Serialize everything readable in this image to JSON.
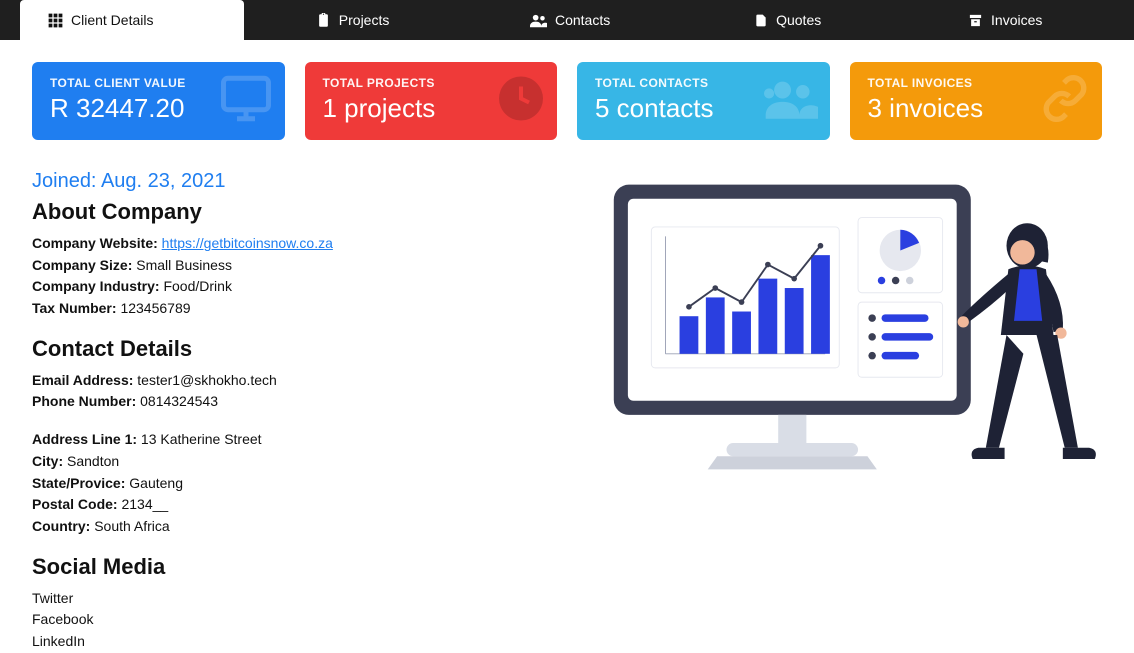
{
  "tabs": [
    {
      "label": "Client Details"
    },
    {
      "label": "Projects"
    },
    {
      "label": "Contacts"
    },
    {
      "label": "Quotes"
    },
    {
      "label": "Invoices"
    }
  ],
  "stats": {
    "client_value": {
      "label": "TOTAL CLIENT VALUE",
      "value": "R 32447.20"
    },
    "projects": {
      "label": "TOTAL PROJECTS",
      "value": "1 projects"
    },
    "contacts": {
      "label": "TOTAL CONTACTS",
      "value": "5 contacts"
    },
    "invoices": {
      "label": "TOTAL INVOICES",
      "value": "3 invoices"
    }
  },
  "joined_label": "Joined: Aug. 23, 2021",
  "about": {
    "heading": "About Company",
    "website_label": "Company Website:",
    "website_value": "https://getbitcoinsnow.co.za",
    "size_label": "Company Size:",
    "size_value": "Small Business",
    "industry_label": "Company Industry:",
    "industry_value": "Food/Drink",
    "tax_label": "Tax Number:",
    "tax_value": "123456789"
  },
  "contact": {
    "heading": "Contact Details",
    "email_label": "Email Address:",
    "email_value": "tester1@skhokho.tech",
    "phone_label": "Phone Number:",
    "phone_value": "0814324543",
    "addr1_label": "Address Line 1:",
    "addr1_value": "13 Katherine Street",
    "city_label": "City:",
    "city_value": "Sandton",
    "state_label": "State/Provice:",
    "state_value": "Gauteng",
    "postal_label": "Postal Code:",
    "postal_value": "2134__",
    "country_label": "Country:",
    "country_value": "South Africa"
  },
  "social": {
    "heading": "Social Media",
    "twitter": "Twitter",
    "facebook": "Facebook",
    "linkedin": "LinkedIn"
  }
}
